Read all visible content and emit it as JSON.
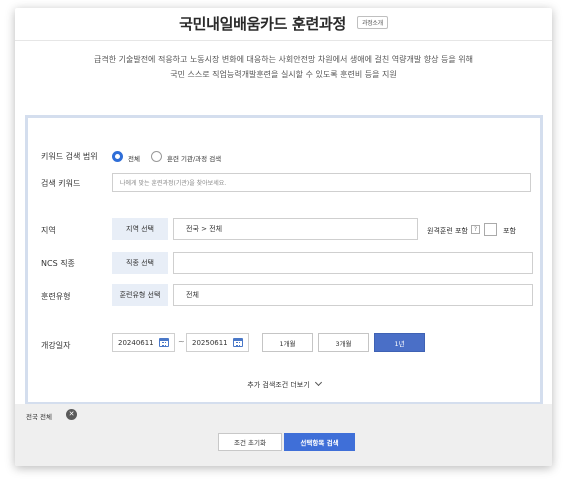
{
  "header": {
    "title": "국민내일배움카드 훈련과정",
    "intro_button": "과정소개",
    "description_line1": "급격한 기술발전에 적응하고 노동시장 변화에 대응하는 사회안전망 차원에서 생애에 걸친 역량개발 향상 등을 위해",
    "description_line2": "국민 스스로 직업능력개발훈련을 실시할 수 있도록 훈련비 등을 지원"
  },
  "search": {
    "keyword_scope_label": "키워드 검색 범위",
    "scope_options": [
      {
        "label": "전체",
        "selected": true
      },
      {
        "label": "훈련 기관/과정 검색",
        "selected": false
      }
    ],
    "keyword_label": "검색 키워드",
    "keyword_placeholder": "나에게 맞는 훈련과정(기관)을 찾아보세요.",
    "region_label": "지역",
    "region_button": "지역 선택",
    "region_value": "전국 > 전체",
    "remote_label": "원격훈련 포함",
    "help_symbol": "?",
    "include_label": "포함",
    "include_checked": false,
    "ncs_label": "NCS 직종",
    "ncs_button": "직종 선택",
    "ncs_value": "",
    "type_label": "훈련유형",
    "type_button": "훈련유형 선택",
    "type_value": "전체",
    "date_label": "개강일자",
    "date_from": "20240611",
    "date_to": "20250611",
    "tilde": "~",
    "periods": [
      {
        "label": "1개월",
        "active": false
      },
      {
        "label": "3개월",
        "active": false
      },
      {
        "label": "1년",
        "active": true
      }
    ],
    "more_conditions": "추가 검색조건 더보기"
  },
  "footer": {
    "chip_label": "전국 전체",
    "chip_close": "✕",
    "reset_button": "조건 초기화",
    "search_button": "선택항목 검색"
  },
  "colors": {
    "accent": "#3f6fd8",
    "active_period": "#4a6fc7",
    "box_border": "#d4deee",
    "select_button_bg": "#e8eef7",
    "footer_bg": "#efefef"
  }
}
